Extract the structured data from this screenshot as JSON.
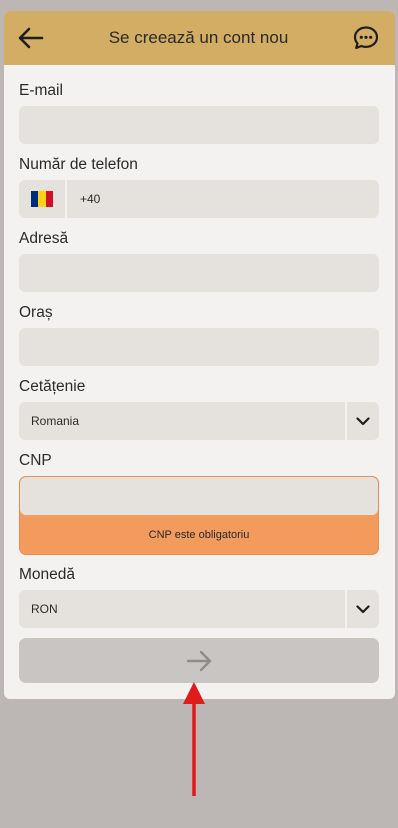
{
  "header": {
    "title": "Se creează un cont nou",
    "icons": {
      "back": "back-arrow-icon",
      "chat": "chat-bubble-icon"
    }
  },
  "form": {
    "email": {
      "label": "E-mail",
      "value": ""
    },
    "phone": {
      "label": "Număr de telefon",
      "prefix": "+40",
      "value": "",
      "flag_colors": [
        "#002b7f",
        "#fcd116",
        "#ce1126"
      ]
    },
    "address": {
      "label": "Adresă",
      "value": ""
    },
    "city": {
      "label": "Oraș",
      "value": ""
    },
    "citizenship": {
      "label": "Cetățenie",
      "selected": "Romania"
    },
    "cnp": {
      "label": "CNP",
      "value": "",
      "error": "CNP este obligatoriu"
    },
    "currency": {
      "label": "Monedă",
      "selected": "RON"
    },
    "submit_icon": "forward-arrow-icon"
  },
  "colors": {
    "header": "#d2ad63",
    "field": "#e5e2de",
    "error": "#f29b5c",
    "submit_disabled": "#c9c5c2",
    "annotation": "#e01b1b"
  }
}
